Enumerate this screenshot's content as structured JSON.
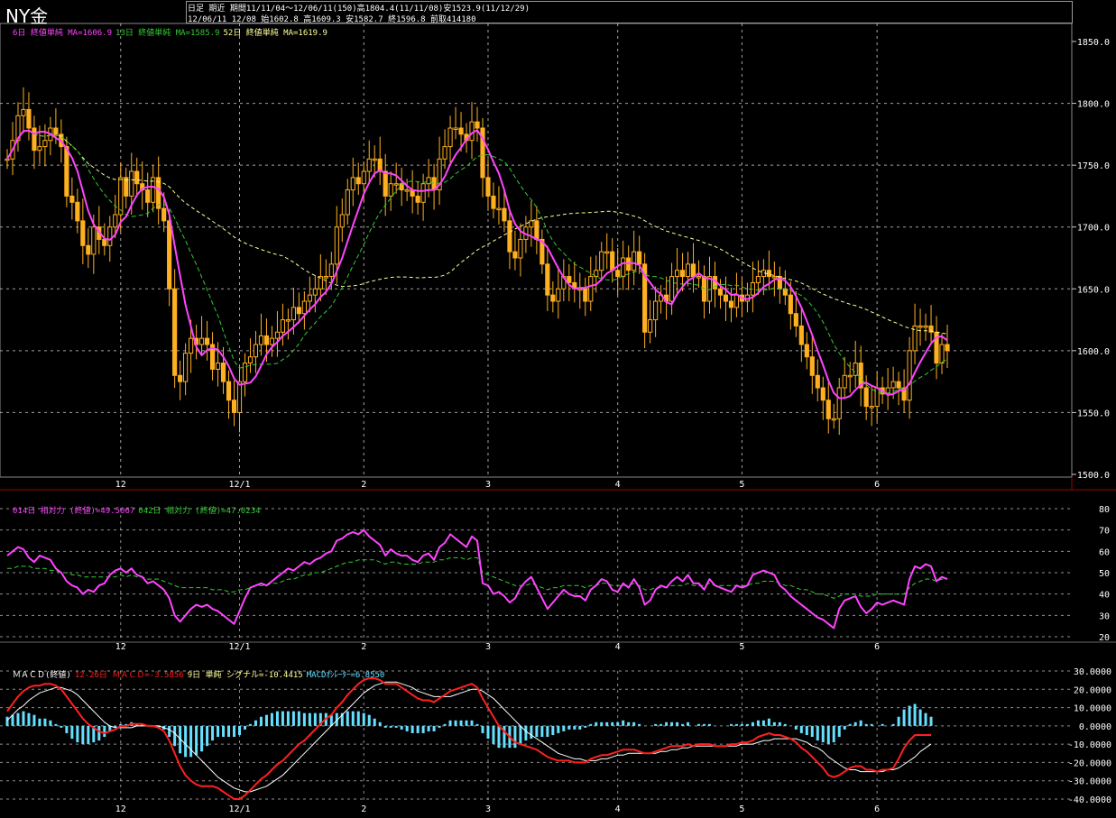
{
  "header": {
    "title": "NY金",
    "line1": "日足 期近 期間11/11/04～12/06/11(150)高1804.4(11/11/08)安1523.9(11/12/29)",
    "line2": "12/06/11 12/08 始1602.8 高1609.3 安1582.7 終1596.8 前取414180"
  },
  "colors": {
    "background": "#000000",
    "grid": "#cccccc",
    "candle": "#ffb020",
    "ma6": "#ff44ff",
    "ma13": "#33cc33",
    "ma52": "#ffff99",
    "rsi14": "#ff44ff",
    "rsi42": "#33cc33",
    "macd": "#ff2020",
    "signal": "#ffffff",
    "histogram": "#66e0ff",
    "divider": "#aa0000"
  },
  "chart_data": [
    {
      "type": "candlestick",
      "title": "NY金",
      "legend": [
        {
          "label": "6日 終値単純 MA=1606.9",
          "color": "#ff44ff"
        },
        {
          "label": "13日 終値単純 MA=1585.9",
          "color": "#33cc33"
        },
        {
          "label": "52日 終値単純 MA=1619.9",
          "color": "#ffff99"
        }
      ],
      "x_ticks": [
        {
          "label": "12",
          "index": 21
        },
        {
          "label": "12/1",
          "index": 43
        },
        {
          "label": "2",
          "index": 66
        },
        {
          "label": "3",
          "index": 89
        },
        {
          "label": "4",
          "index": 113
        },
        {
          "label": "5",
          "index": 136
        },
        {
          "label": "6",
          "index": 161
        }
      ],
      "y_ticks": [
        "1850.0",
        "1800.0",
        "1750.0",
        "1700.0",
        "1650.0",
        "1600.0",
        "1550.0",
        "1500.0"
      ],
      "ylim": [
        1500,
        1850
      ],
      "close": [
        1755,
        1770,
        1790,
        1795,
        1780,
        1762,
        1765,
        1770,
        1780,
        1775,
        1765,
        1725,
        1720,
        1705,
        1685,
        1678,
        1700,
        1690,
        1685,
        1700,
        1710,
        1740,
        1725,
        1745,
        1735,
        1730,
        1720,
        1740,
        1715,
        1705,
        1650,
        1580,
        1575,
        1598,
        1610,
        1605,
        1610,
        1605,
        1585,
        1590,
        1575,
        1560,
        1550,
        1575,
        1590,
        1595,
        1605,
        1612,
        1605,
        1610,
        1615,
        1625,
        1625,
        1635,
        1630,
        1640,
        1645,
        1650,
        1660,
        1660,
        1670,
        1700,
        1710,
        1730,
        1740,
        1735,
        1745,
        1755,
        1755,
        1745,
        1725,
        1735,
        1735,
        1730,
        1730,
        1725,
        1720,
        1735,
        1740,
        1730,
        1755,
        1765,
        1780,
        1780,
        1775,
        1770,
        1785,
        1780,
        1740,
        1725,
        1715,
        1715,
        1705,
        1680,
        1675,
        1690,
        1700,
        1705,
        1690,
        1670,
        1645,
        1640,
        1650,
        1660,
        1655,
        1650,
        1650,
        1640,
        1660,
        1665,
        1680,
        1680,
        1665,
        1660,
        1675,
        1665,
        1680,
        1670,
        1615,
        1625,
        1640,
        1645,
        1640,
        1660,
        1665,
        1660,
        1670,
        1660,
        1660,
        1640,
        1660,
        1650,
        1645,
        1640,
        1635,
        1645,
        1640,
        1645,
        1655,
        1660,
        1665,
        1660,
        1660,
        1650,
        1645,
        1630,
        1620,
        1605,
        1595,
        1580,
        1570,
        1560,
        1545,
        1545,
        1570,
        1580,
        1580,
        1590,
        1570,
        1555,
        1555,
        1570,
        1565,
        1570,
        1575,
        1570,
        1560,
        1600,
        1620,
        1620,
        1620,
        1615,
        1590,
        1605,
        1600
      ]
    },
    {
      "type": "line",
      "legend": [
        {
          "label": "014日 相対力 (終値)=49.5067",
          "color": "#ff44ff"
        },
        {
          "label": "042日 相対力 (終値)=47.0234",
          "color": "#33cc33"
        }
      ],
      "y_ticks": [
        "80",
        "70",
        "60",
        "50",
        "40",
        "30",
        "20"
      ],
      "ylim": [
        20,
        80
      ],
      "series": [
        {
          "name": "014日 相対力 (終値)",
          "values": [
            58,
            60,
            62,
            61,
            57,
            55,
            58,
            57,
            56,
            52,
            50,
            46,
            44,
            43,
            40,
            42,
            41,
            44,
            45,
            49,
            51,
            52,
            50,
            52,
            49,
            48,
            45,
            46,
            44,
            42,
            38,
            30,
            27,
            30,
            33,
            35,
            34,
            35,
            33,
            32,
            30,
            28,
            26,
            32,
            38,
            43,
            44,
            45,
            44,
            46,
            48,
            50,
            52,
            51,
            53,
            55,
            54,
            56,
            57,
            59,
            60,
            65,
            66,
            68,
            69,
            68,
            70,
            67,
            65,
            63,
            58,
            61,
            59,
            58,
            58,
            56,
            55,
            58,
            59,
            56,
            62,
            64,
            68,
            66,
            64,
            62,
            67,
            65,
            45,
            44,
            40,
            41,
            39,
            36,
            38,
            43,
            46,
            48,
            43,
            38,
            33,
            36,
            39,
            42,
            40,
            39,
            39,
            37,
            42,
            44,
            47,
            46,
            42,
            41,
            45,
            43,
            47,
            43,
            35,
            37,
            42,
            44,
            43,
            46,
            48,
            46,
            49,
            45,
            45,
            42,
            47,
            44,
            43,
            42,
            41,
            44,
            43,
            44,
            49,
            50,
            51,
            50,
            49,
            44,
            42,
            39,
            37,
            35,
            33,
            31,
            29,
            28,
            26,
            24,
            33,
            37,
            38,
            39,
            34,
            31,
            33,
            36,
            35,
            36,
            37,
            36,
            35,
            47,
            53,
            52,
            54,
            53,
            46,
            48,
            47
          ]
        },
        {
          "name": "042日 相対力 (終値)",
          "values": [
            52,
            52,
            53,
            53,
            53,
            52,
            52,
            52,
            51,
            51,
            50,
            50,
            49,
            49,
            48,
            48,
            48,
            48,
            48,
            48,
            48,
            49,
            48,
            49,
            48,
            48,
            47,
            47,
            47,
            46,
            45,
            44,
            43,
            43,
            43,
            43,
            43,
            43,
            42,
            42,
            42,
            41,
            41,
            42,
            42,
            43,
            44,
            44,
            44,
            45,
            45,
            46,
            47,
            47,
            48,
            49,
            49,
            50,
            50,
            51,
            52,
            53,
            54,
            55,
            55,
            56,
            56,
            56,
            56,
            55,
            54,
            55,
            55,
            54,
            54,
            54,
            54,
            55,
            55,
            55,
            56,
            56,
            57,
            57,
            57,
            56,
            57,
            57,
            50,
            49,
            48,
            47,
            46,
            45,
            44,
            44,
            44,
            45,
            44,
            43,
            42,
            43,
            43,
            44,
            44,
            44,
            44,
            43,
            44,
            44,
            45,
            45,
            44,
            44,
            44,
            44,
            45,
            44,
            42,
            42,
            43,
            43,
            43,
            44,
            44,
            44,
            45,
            44,
            44,
            44,
            45,
            44,
            44,
            44,
            44,
            44,
            44,
            44,
            45,
            45,
            46,
            46,
            46,
            45,
            44,
            44,
            43,
            42,
            42,
            41,
            40,
            40,
            39,
            38,
            39,
            40,
            40,
            40,
            39,
            39,
            39,
            40,
            40,
            40,
            40,
            40,
            40,
            43,
            45,
            46,
            47,
            47,
            46,
            47,
            47
          ]
        }
      ]
    },
    {
      "type": "line",
      "legend": [
        {
          "label": "ＭＡＣＤ(終値)",
          "color": "#ffffff"
        },
        {
          "label": "12-26日 ＭＡＣＤ=-3.5856",
          "color": "#ff2020"
        },
        {
          "label": "9日 単純 シグナル=-10.4415",
          "color": "#ffff99"
        },
        {
          "label": "MACDｵｼﾚｰﾀｰ=6.8550",
          "color": "#66e0ff"
        }
      ],
      "y_ticks": [
        "30.0000",
        "20.0000",
        "10.0000",
        "0.0000",
        "-10.0000",
        "-20.0000",
        "-30.0000",
        "-40.0000"
      ],
      "ylim": [
        -40,
        30
      ],
      "series": [
        {
          "name": "12-26日 ＭＡＣＤ",
          "values": [
            8,
            12,
            16,
            19,
            21,
            22,
            22,
            23,
            23,
            22,
            20,
            16,
            12,
            8,
            4,
            1,
            -1,
            -3,
            -4,
            -3,
            -2,
            0,
            0,
            1,
            1,
            1,
            0,
            0,
            -1,
            -3,
            -8,
            -15,
            -22,
            -27,
            -30,
            -32,
            -33,
            -33,
            -33,
            -34,
            -36,
            -38,
            -40,
            -40,
            -38,
            -35,
            -32,
            -29,
            -27,
            -24,
            -21,
            -19,
            -16,
            -13,
            -10,
            -8,
            -5,
            -2,
            1,
            4,
            6,
            10,
            13,
            17,
            20,
            23,
            25,
            26,
            26,
            25,
            23,
            23,
            23,
            21,
            19,
            17,
            15,
            14,
            14,
            13,
            15,
            17,
            19,
            20,
            21,
            22,
            23,
            21,
            15,
            10,
            5,
            0,
            -3,
            -6,
            -9,
            -10,
            -11,
            -12,
            -13,
            -15,
            -17,
            -18,
            -19,
            -19,
            -19,
            -20,
            -20,
            -20,
            -18,
            -17,
            -16,
            -16,
            -15,
            -14,
            -13,
            -13,
            -13,
            -14,
            -15,
            -15,
            -14,
            -13,
            -12,
            -11,
            -11,
            -11,
            -10,
            -11,
            -10,
            -10,
            -10,
            -11,
            -11,
            -11,
            -10,
            -10,
            -9,
            -9,
            -8,
            -6,
            -5,
            -4,
            -5,
            -5,
            -6,
            -7,
            -9,
            -12,
            -14,
            -17,
            -20,
            -23,
            -27,
            -28,
            -27,
            -25,
            -23,
            -22,
            -22,
            -24,
            -24,
            -25,
            -24,
            -24,
            -23,
            -18,
            -12,
            -8,
            -5,
            -5,
            -5,
            -5
          ]
        },
        {
          "name": "9日 単純 シグナル",
          "values": [
            3,
            6,
            9,
            11,
            14,
            16,
            18,
            19,
            20,
            21,
            21,
            20,
            19,
            17,
            14,
            11,
            8,
            5,
            2,
            0,
            -1,
            -1,
            -1,
            -1,
            0,
            0,
            0,
            0,
            0,
            -1,
            -2,
            -4,
            -7,
            -10,
            -13,
            -16,
            -19,
            -22,
            -25,
            -28,
            -30,
            -32,
            -34,
            -35,
            -36,
            -36,
            -35,
            -34,
            -33,
            -31,
            -29,
            -27,
            -24,
            -21,
            -18,
            -15,
            -12,
            -9,
            -6,
            -3,
            0,
            3,
            6,
            9,
            12,
            15,
            18,
            20,
            22,
            23,
            24,
            24,
            24,
            23,
            22,
            21,
            19,
            18,
            17,
            16,
            16,
            16,
            16,
            17,
            18,
            19,
            20,
            20,
            19,
            17,
            15,
            12,
            9,
            6,
            3,
            0,
            -3,
            -5,
            -7,
            -9,
            -11,
            -13,
            -15,
            -16,
            -17,
            -18,
            -18,
            -19,
            -19,
            -19,
            -18,
            -18,
            -17,
            -16,
            -16,
            -15,
            -15,
            -15,
            -15,
            -15,
            -15,
            -14,
            -14,
            -13,
            -13,
            -12,
            -12,
            -11,
            -11,
            -11,
            -11,
            -11,
            -11,
            -11,
            -11,
            -11,
            -10,
            -10,
            -10,
            -9,
            -8,
            -8,
            -7,
            -7,
            -7,
            -7,
            -7,
            -8,
            -9,
            -11,
            -12,
            -14,
            -17,
            -19,
            -21,
            -23,
            -24,
            -24,
            -25,
            -25,
            -25,
            -25,
            -25,
            -24,
            -24,
            -23,
            -21,
            -19,
            -17,
            -14,
            -12,
            -10
          ]
        },
        {
          "name": "MACDｵｼﾚｰﾀｰ",
          "values": [
            5,
            6,
            7,
            8,
            7,
            6,
            4,
            4,
            3,
            1,
            -1,
            -4,
            -7,
            -9,
            -10,
            -10,
            -9,
            -8,
            -6,
            -3,
            -1,
            1,
            1,
            2,
            1,
            1,
            0,
            0,
            -1,
            -2,
            -6,
            -11,
            -15,
            -17,
            -17,
            -16,
            -14,
            -11,
            -8,
            -6,
            -6,
            -6,
            -6,
            -5,
            -2,
            1,
            3,
            5,
            6,
            7,
            8,
            8,
            8,
            8,
            8,
            7,
            7,
            7,
            7,
            7,
            6,
            7,
            7,
            8,
            8,
            8,
            7,
            6,
            4,
            2,
            -1,
            -1,
            -1,
            -2,
            -3,
            -4,
            -4,
            -4,
            -3,
            -3,
            -1,
            1,
            3,
            3,
            3,
            3,
            3,
            1,
            -4,
            -7,
            -10,
            -12,
            -12,
            -12,
            -12,
            -10,
            -8,
            -7,
            -6,
            -6,
            -6,
            -5,
            -4,
            -3,
            -2,
            -2,
            -2,
            -1,
            1,
            2,
            2,
            2,
            2,
            2,
            3,
            2,
            2,
            1,
            0,
            0,
            1,
            1,
            2,
            2,
            2,
            1,
            2,
            0,
            1,
            1,
            1,
            0,
            0,
            0,
            1,
            1,
            1,
            1,
            2,
            3,
            3,
            4,
            2,
            2,
            1,
            0,
            -2,
            -4,
            -5,
            -6,
            -8,
            -9,
            -10,
            -9,
            -6,
            -2,
            1,
            2,
            3,
            1,
            1,
            0,
            1,
            0,
            1,
            5,
            9,
            11,
            12,
            9,
            7,
            5
          ]
        }
      ]
    }
  ]
}
